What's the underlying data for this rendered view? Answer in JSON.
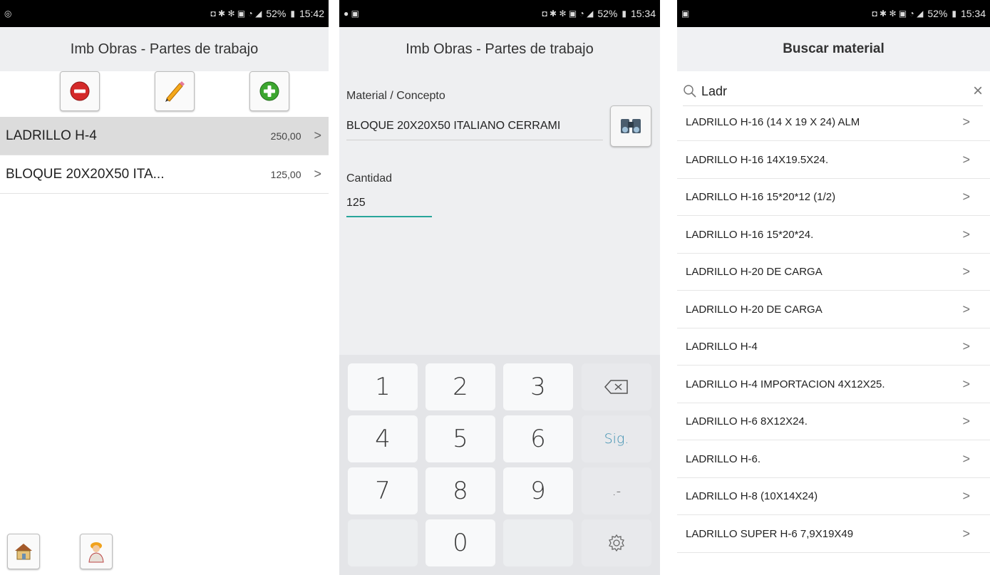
{
  "screen1": {
    "status": {
      "time": "15:42",
      "battery": "52%"
    },
    "title": "Imb Obras - Partes de trabajo",
    "toolbar": {
      "delete_icon": "minus-circle-icon",
      "edit_icon": "pencil-icon",
      "add_icon": "plus-circle-icon"
    },
    "items": [
      {
        "name": "LADRILLO H-4",
        "qty": "250,00",
        "chevron": ">",
        "selected": true
      },
      {
        "name": "BLOQUE 20X20X50 ITA...",
        "qty": "125,00",
        "chevron": ">",
        "selected": false
      }
    ],
    "bottom_icons": [
      "house-icon",
      "worker-icon"
    ]
  },
  "screen2": {
    "status": {
      "time": "15:34",
      "battery": "52%"
    },
    "title": "Imb Obras - Partes de trabajo",
    "material_label": "Material / Concepto",
    "material_value": "BLOQUE 20X20X50 ITALIANO CERRAMI",
    "search_button_icon": "binoculars-icon",
    "cantidad_label": "Cantidad",
    "cantidad_value": "125",
    "accent_color": "#27a59a",
    "keypad": {
      "keys": [
        "1",
        "2",
        "3",
        "4",
        "5",
        "6",
        "7",
        "8",
        "9",
        "0"
      ],
      "next_label": "Sig.",
      "punct_label": ".-",
      "backspace_icon": "backspace-icon",
      "settings_icon": "gear-icon"
    }
  },
  "screen3": {
    "status": {
      "time": "15:34",
      "battery": "52%"
    },
    "title": "Buscar material",
    "search": {
      "value": "Ladr",
      "icon": "search-icon",
      "clear": "×"
    },
    "results": [
      "LADRILLO H-16 (14 X 19 X 24) ALM",
      "LADRILLO H-16 14X19.5X24.",
      "LADRILLO H-16 15*20*12 (1/2)",
      "LADRILLO H-16 15*20*24.",
      "LADRILLO H-20  DE CARGA",
      "LADRILLO H-20 DE CARGA",
      "LADRILLO H-4",
      "LADRILLO H-4 IMPORTACION 4X12X25.",
      "LADRILLO H-6 8X12X24.",
      "LADRILLO H-6.",
      "LADRILLO H-8 (10X14X24)",
      "LADRILLO SUPER H-6 7,9X19X49"
    ],
    "chevron": ">"
  }
}
